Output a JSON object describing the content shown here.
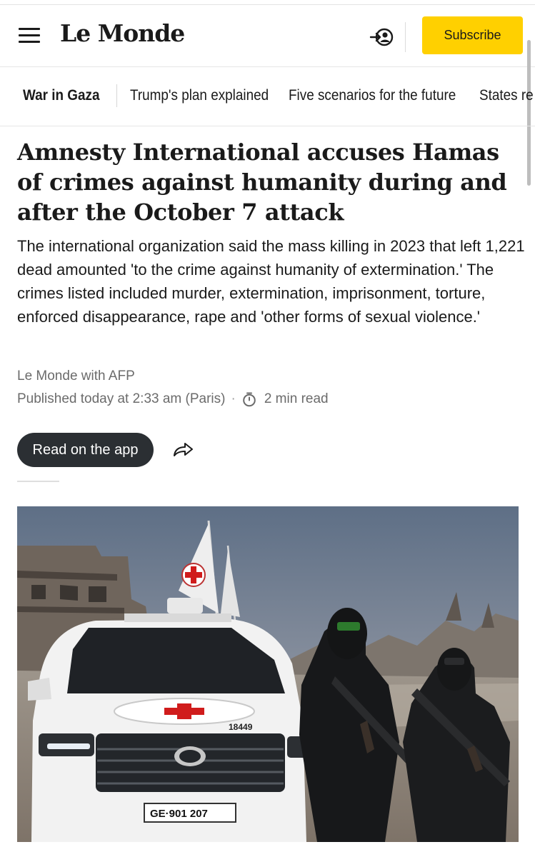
{
  "header": {
    "logo": "Le Monde",
    "subscribe_label": "Subscribe"
  },
  "nav": {
    "items": [
      "War in Gaza",
      "Trump's plan explained",
      "Five scenarios for the future",
      "States re"
    ]
  },
  "article": {
    "headline": "Amnesty International accuses Hamas of crimes against humanity during and after the October 7 attack",
    "standfirst": "The international organization said the mass killing in 2023 that left 1,221 dead amounted 'to the crime against humanity of extermination.' The crimes listed included murder, extermination, imprisonment, torture, enforced disappearance, rape and 'other forms of sexual violence.'",
    "byline": "Le Monde with AFP",
    "published": "Published today at 2:33 am (Paris)",
    "separator": "·",
    "read_time": "2 min read",
    "read_app_label": "Read on the app"
  },
  "photo": {
    "plate": "GE·901 207",
    "vehicle_number": "18449"
  },
  "colors": {
    "accent": "#ffd000",
    "dark_button": "#2b2f33",
    "meta_text": "#6b6b6b"
  },
  "icons": [
    "menu-icon",
    "account-icon",
    "timer-icon",
    "share-icon"
  ]
}
